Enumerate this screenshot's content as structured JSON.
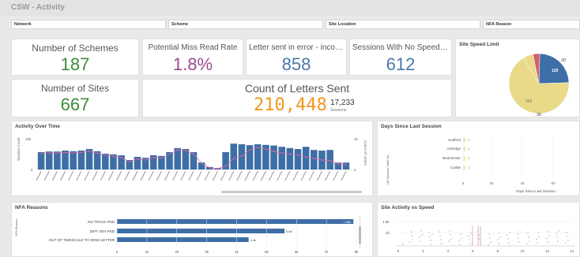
{
  "app_title": "CSW - Activity",
  "filters": [
    "Network",
    "Scheme",
    "Site Location",
    "NFA Reason"
  ],
  "kpis": {
    "schemes": {
      "label": "Number of Schemes",
      "value": "187",
      "color": "#3c8c3c"
    },
    "miss_rate": {
      "label": "Potential Miss Read Rate",
      "value": "1.8%",
      "color": "#9c4a92"
    },
    "letters_error": {
      "label": "Letter sent in error - incorrect ...",
      "value": "858",
      "color": "#4a78a8"
    },
    "no_speeding": {
      "label": "Sessions With No Speeding V...",
      "value": "612",
      "color": "#4a78a8"
    },
    "sites": {
      "label": "Number of Sites",
      "value": "667",
      "color": "#3c8c3c"
    },
    "letters_sent": {
      "label": "Count of Letters Sent",
      "value": "210,448",
      "color": "#f0961e",
      "secondary_value": "17,233",
      "secondary_label": "Sessions"
    }
  },
  "colors": {
    "bar_blue": "#3e6ea6",
    "line_pink": "#e06aa0",
    "speed_yellow": "#e8da88",
    "speed_blue": "#3e6ea6",
    "speed_red": "#d06070"
  },
  "charts": {
    "site_speed": {
      "title": "Site Speed Limit"
    },
    "activity": {
      "title": "Activity Over Time",
      "y_left": "Session Count",
      "y_right": "Count of Letters",
      "left_top": "10k",
      "left_zero": "0",
      "right_top": "1k",
      "right_zero": "0"
    },
    "days_since": {
      "title": "Days Since Last Session",
      "x_label": "Days Since Last Session",
      "y_label": "UR Queens Valid Nu..."
    },
    "nfa": {
      "title": "NFA Reasons",
      "y_label": "NFA Reason"
    },
    "site_activity": {
      "title": "Site Activity vs Speed"
    }
  },
  "chart_data": [
    {
      "type": "pie",
      "title": "Site Speed Limit",
      "slices": [
        {
          "label": "30",
          "value": 30,
          "color": "#e8da88"
        },
        {
          "label": "20",
          "value": 20,
          "color": "#d06070"
        },
        {
          "label": "129",
          "value": 129,
          "color": "#3e6ea6"
        },
        {
          "label": "359",
          "value": 359,
          "color": "#e8da88"
        }
      ],
      "labels_shown": [
        "20",
        "129",
        "359",
        "30"
      ]
    },
    {
      "type": "bar",
      "title": "Activity Over Time",
      "bars": [
        55,
        57,
        57,
        60,
        58,
        60,
        65,
        58,
        50,
        48,
        45,
        30,
        40,
        37,
        45,
        43,
        55,
        68,
        65,
        55,
        22,
        8,
        5,
        55,
        82,
        80,
        77,
        80,
        78,
        76,
        72,
        68,
        65,
        72,
        62,
        60,
        62,
        22,
        22
      ],
      "line": [
        50,
        52,
        52,
        54,
        52,
        54,
        58,
        52,
        45,
        42,
        38,
        25,
        33,
        30,
        38,
        36,
        48,
        62,
        60,
        50,
        20,
        5,
        3,
        10,
        35,
        42,
        62,
        70,
        65,
        58,
        52,
        50,
        45,
        40,
        35,
        30,
        28,
        18,
        15
      ],
      "y_left_ticks": [
        "10k",
        "0"
      ],
      "y_right_ticks": [
        "1k",
        "0"
      ]
    },
    {
      "type": "bar",
      "title": "Days Since Last Session",
      "categories": [
        "Hudford",
        "Axbridge",
        "Beaminster",
        "Castle"
      ],
      "values": [
        1,
        1,
        1,
        1
      ],
      "value_labels": [
        "1",
        "1",
        "1",
        "1"
      ],
      "x_ticks": [
        "0",
        "20",
        "40",
        "60"
      ],
      "xlabel": "Days Since Last Session"
    },
    {
      "type": "bar",
      "title": "NFA Reasons",
      "categories": [
        "NO TRACE PND",
        "DIFF VEH PND",
        "OUT OF TIMESCALE TO SEND LETTER"
      ],
      "values": [
        7900,
        5600,
        4400
      ],
      "value_labels": [
        "7.96k",
        "5.6k",
        "4.4k"
      ],
      "x_ticks": [
        "0",
        "1k",
        "2k",
        "3k",
        "4k",
        "5k",
        "6k",
        "7k",
        "8k"
      ],
      "xlim": [
        0,
        8000
      ]
    },
    {
      "type": "scatter",
      "title": "Site Activity vs Speed",
      "y_ticks": [
        "1.5k",
        "1k"
      ],
      "x_ticks": [
        "0",
        "2",
        "4",
        "6",
        "8",
        "10",
        "12",
        "14"
      ]
    }
  ]
}
